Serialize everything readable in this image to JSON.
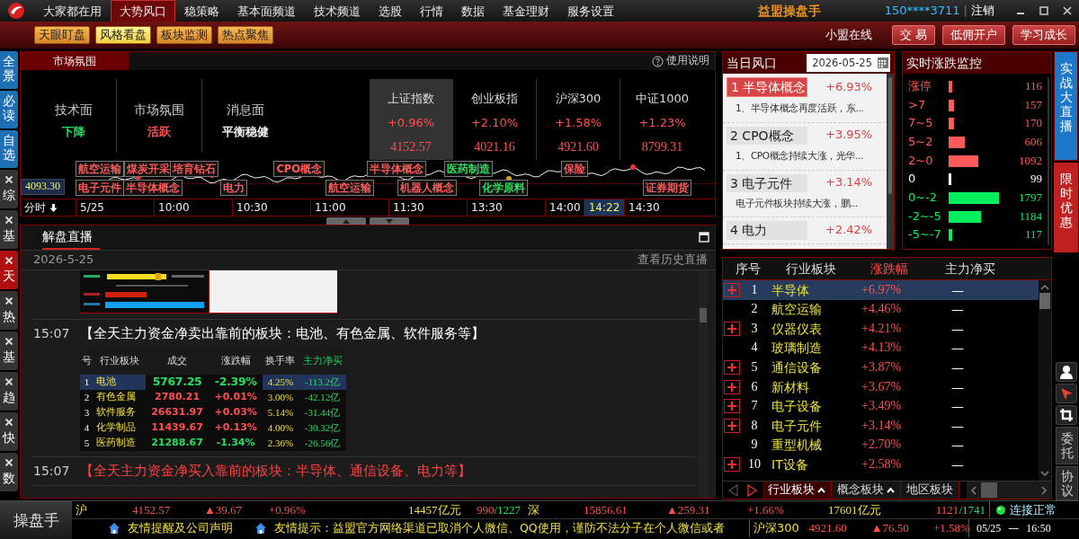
{
  "menu": {
    "items": [
      {
        "label": "大家都在用",
        "selected": false
      },
      {
        "label": "大势风口",
        "selected": true
      },
      {
        "label": "稳策略",
        "selected": false
      },
      {
        "label": "基本面频道",
        "selected": false
      },
      {
        "label": "技术频道",
        "selected": false
      },
      {
        "label": "选股",
        "selected": false
      },
      {
        "label": "行情",
        "selected": false
      },
      {
        "label": "数据",
        "selected": false
      },
      {
        "label": "基金理财",
        "selected": false
      },
      {
        "label": "服务设置",
        "selected": false
      }
    ],
    "brand": "益盟操盘手",
    "account": "150****3711",
    "separator": "|",
    "logout": "注销"
  },
  "toolbar": {
    "modes": [
      {
        "label": "天眼盯盘",
        "selected": false
      },
      {
        "label": "风格看盘",
        "selected": true
      },
      {
        "label": "板块监测",
        "selected": false
      },
      {
        "label": "热点聚焦",
        "selected": false
      }
    ],
    "online": "小盟在线",
    "actions": [
      "交 易",
      "低佣开户",
      "学习成长"
    ]
  },
  "side_tabs": [
    {
      "label": "全景",
      "kind": "pinned",
      "selected": false
    },
    {
      "label": "必读",
      "kind": "pinned",
      "selected": false
    },
    {
      "label": "自选",
      "kind": "pinned",
      "selected": false
    },
    {
      "label": "综",
      "kind": "closable",
      "selected": false
    },
    {
      "label": "基",
      "kind": "closable",
      "selected": false
    },
    {
      "label": "天",
      "kind": "closable",
      "selected": true
    },
    {
      "label": "热",
      "kind": "closable",
      "selected": false
    },
    {
      "label": "基",
      "kind": "closable",
      "selected": false
    },
    {
      "label": "趋",
      "kind": "closable",
      "selected": false
    },
    {
      "label": "快",
      "kind": "closable",
      "selected": false
    },
    {
      "label": "数",
      "kind": "closable",
      "selected": false
    }
  ],
  "market": {
    "tab": "市场氛围",
    "help": "使用说明",
    "moods": [
      {
        "label": "技术面",
        "value": "下降",
        "color": "#20e060"
      },
      {
        "label": "市场氛围",
        "value": "活跃",
        "color": "#ff5050"
      },
      {
        "label": "消息面",
        "value": "平衡稳健",
        "color": "#f0f0f0"
      }
    ],
    "indices": [
      {
        "name": "上证指数",
        "change": "+0.96%",
        "price": "4152.57",
        "selected": true
      },
      {
        "name": "创业板指",
        "change": "+2.10%",
        "price": "4021.16",
        "selected": false
      },
      {
        "name": "沪深300",
        "change": "+1.58%",
        "price": "4921.60",
        "selected": false
      },
      {
        "name": "中证1000",
        "change": "+1.23%",
        "price": "8799.31",
        "selected": false
      }
    ],
    "price_label": "4093.30",
    "tags_top": [
      {
        "label": "航空运输",
        "color": "#ff5a5a"
      },
      {
        "label": "煤炭开采",
        "color": "#ff5a5a"
      },
      {
        "label": "培育钻石",
        "color": "#ff5a5a"
      },
      {
        "label": "CPO概念",
        "color": "#ff5a5a"
      },
      {
        "label": "半导体概念",
        "color": "#ff5a5a"
      },
      {
        "label": "医药制造",
        "color": "#30e060"
      },
      {
        "label": "保险",
        "color": "#ff5a5a"
      }
    ],
    "tags_bottom": [
      {
        "label": "电子元件",
        "color": "#ff5a5a"
      },
      {
        "label": "半导体概念",
        "color": "#ff5a5a"
      },
      {
        "label": "电力",
        "color": "#ff5a5a"
      },
      {
        "label": "航空运输",
        "color": "#ff5a5a"
      },
      {
        "label": "机器人概念",
        "color": "#ff5a5a"
      },
      {
        "label": "化学原料",
        "color": "#30e060"
      },
      {
        "label": "证券期货",
        "color": "#ff5a5a"
      }
    ],
    "period": "分时",
    "times": [
      {
        "label": "5/25",
        "selected": false
      },
      {
        "label": "10:00",
        "selected": false
      },
      {
        "label": "10:30",
        "selected": false
      },
      {
        "label": "11:00",
        "selected": false
      },
      {
        "label": "11:30",
        "selected": false
      },
      {
        "label": "13:30",
        "selected": false
      },
      {
        "label": "14:00",
        "selected": false
      },
      {
        "label": "14:22",
        "selected": true
      },
      {
        "label": "14:30",
        "selected": false
      }
    ]
  },
  "live": {
    "tab": "解盘直播",
    "date": "2026-5-25",
    "history": "查看历史直播",
    "posts": [
      {
        "kind": "picture"
      },
      {
        "kind": "table",
        "time": "15:07",
        "title": "【全天主力资金净卖出靠前的板块：电池、有色金属、软件服务等】",
        "color": "#ffffff",
        "columns": [
          {
            "label": "号",
            "highlight": false
          },
          {
            "label": "行业板块",
            "highlight": false
          },
          {
            "label": "成交",
            "highlight": false
          },
          {
            "label": "涨跌幅",
            "highlight": false
          },
          {
            "label": "换手率",
            "highlight": false
          },
          {
            "label": "主力净买",
            "highlight": true
          }
        ],
        "rows": [
          {
            "rank": "1",
            "name": "电池",
            "amount": "5767.25",
            "change": "-2.39%",
            "turnover": "4.25%",
            "net": "-113.2亿",
            "color": "#20e060",
            "selected": true
          },
          {
            "rank": "2",
            "name": "有色金属",
            "amount": "2780.21",
            "change": "+0.01%",
            "turnover": "3.00%",
            "net": "-42.12亿",
            "color": "#ff5050",
            "selected": false
          },
          {
            "rank": "3",
            "name": "软件服务",
            "amount": "26631.97",
            "change": "+0.03%",
            "turnover": "5.14%",
            "net": "-31.44亿",
            "color": "#ff5050",
            "selected": false
          },
          {
            "rank": "4",
            "name": "化学制品",
            "amount": "11439.67",
            "change": "+0.13%",
            "turnover": "4.00%",
            "net": "-30.32亿",
            "color": "#ff5050",
            "selected": false
          },
          {
            "rank": "5",
            "name": "医药制造",
            "amount": "21288.67",
            "change": "-1.34%",
            "turnover": "2.36%",
            "net": "-26.56亿",
            "color": "#20e060",
            "selected": false
          }
        ]
      },
      {
        "kind": "text",
        "time": "15:07",
        "title": "【全天主力资金净买入靠前的板块：半导体、通信设备、电力等】",
        "color": "#ff4040"
      }
    ]
  },
  "tuyere": {
    "title": "当日风口",
    "date": "2026-05-25",
    "items": [
      {
        "label": "1 半导体概念",
        "change": "+6.93%",
        "note": "1、半导体概念再度活跃，东...",
        "selected": true
      },
      {
        "label": "2 CPO概念",
        "change": "+3.95%",
        "note": "1、CPO概念持续大涨，光华...",
        "selected": false
      },
      {
        "label": "3 电子元件",
        "change": "+3.14%",
        "note": "电子元件板块持续大涨，鹏...",
        "selected": false
      },
      {
        "label": "4 电力",
        "change": "+2.42%",
        "selected": false
      }
    ]
  },
  "monitor": {
    "title": "实时涨跌监控",
    "rows": [
      {
        "label": "涨停",
        "count": "116",
        "color": "#ff5a5a"
      },
      {
        "label": ">7",
        "count": "157",
        "color": "#ff5a5a"
      },
      {
        "label": "7~5",
        "count": "170",
        "color": "#ff5a5a"
      },
      {
        "label": "5~2",
        "count": "606",
        "color": "#ff5a5a"
      },
      {
        "label": "2~0",
        "count": "1092",
        "color": "#ff5a5a"
      },
      {
        "label": "0",
        "count": "99",
        "color": "#ffffff"
      },
      {
        "label": "0~-2",
        "count": "1797",
        "color": "#00f060"
      },
      {
        "label": "-2~-5",
        "count": "1184",
        "color": "#00f060"
      },
      {
        "label": "-5~-7",
        "count": "117",
        "color": "#00f060"
      }
    ]
  },
  "sectors": {
    "columns": [
      {
        "label": "序号",
        "selected": false
      },
      {
        "label": "行业板块",
        "selected": false
      },
      {
        "label": "涨跌幅",
        "selected": true
      },
      {
        "label": "主力净买",
        "selected": false
      }
    ],
    "rows": [
      {
        "rank": "1",
        "name": "半导体",
        "change": "+6.97%",
        "net": "—",
        "expandable": true,
        "selected": true
      },
      {
        "rank": "2",
        "name": "航空运输",
        "change": "+4.46%",
        "net": "—",
        "expandable": false,
        "selected": false
      },
      {
        "rank": "3",
        "name": "仪器仪表",
        "change": "+4.21%",
        "net": "—",
        "expandable": true,
        "selected": false
      },
      {
        "rank": "4",
        "name": "玻璃制造",
        "change": "+4.13%",
        "net": "—",
        "expandable": false,
        "selected": false
      },
      {
        "rank": "5",
        "name": "通信设备",
        "change": "+3.87%",
        "net": "—",
        "expandable": true,
        "selected": false
      },
      {
        "rank": "6",
        "name": "新材料",
        "change": "+3.67%",
        "net": "—",
        "expandable": true,
        "selected": false
      },
      {
        "rank": "7",
        "name": "电子设备",
        "change": "+3.49%",
        "net": "—",
        "expandable": true,
        "selected": false
      },
      {
        "rank": "8",
        "name": "电子元件",
        "change": "+3.14%",
        "net": "—",
        "expandable": true,
        "selected": false
      },
      {
        "rank": "9",
        "name": "重型机械",
        "change": "+2.70%",
        "net": "—",
        "expandable": false,
        "selected": false
      },
      {
        "rank": "10",
        "name": "IT设备",
        "change": "+2.58%",
        "net": "—",
        "expandable": true,
        "selected": false
      }
    ],
    "tabs": [
      {
        "label": "行业板块",
        "selected": true,
        "sortable": true
      },
      {
        "label": "概念板块",
        "selected": false,
        "sortable": true
      },
      {
        "label": "地区板块",
        "selected": false,
        "sortable": false
      }
    ]
  },
  "promos": [
    {
      "label": "实战大直播",
      "kind": "live"
    },
    {
      "label": "限时优惠",
      "kind": "offer"
    }
  ],
  "side_buttons": [
    "委托",
    "协议"
  ],
  "status": {
    "logo": "操盘手",
    "quotes": [
      {
        "market": "沪",
        "price": "4152.57",
        "delta": "▲39.67",
        "change": "+0.96%",
        "volume": "14457亿元",
        "advancers": "990",
        "decliners": "/1227"
      },
      {
        "market": "深",
        "price": "15856.61",
        "delta": "▲259.31",
        "change": "+1.66%",
        "volume": "17601亿元",
        "advancers": "1121",
        "decliners": "/1741"
      }
    ],
    "connection": "连接正常",
    "notices": [
      "友情提醒及公司声明",
      "友情提示：益盟官方网络渠道已取消个人微信、QQ使用，谨防不法分子在个人微信或者"
    ],
    "index": {
      "name": "沪深300",
      "price": "4921.60",
      "delta": "▲76.50",
      "change": "+1.58%"
    },
    "date": "05/25",
    "dash": "—",
    "time": "16:50"
  }
}
